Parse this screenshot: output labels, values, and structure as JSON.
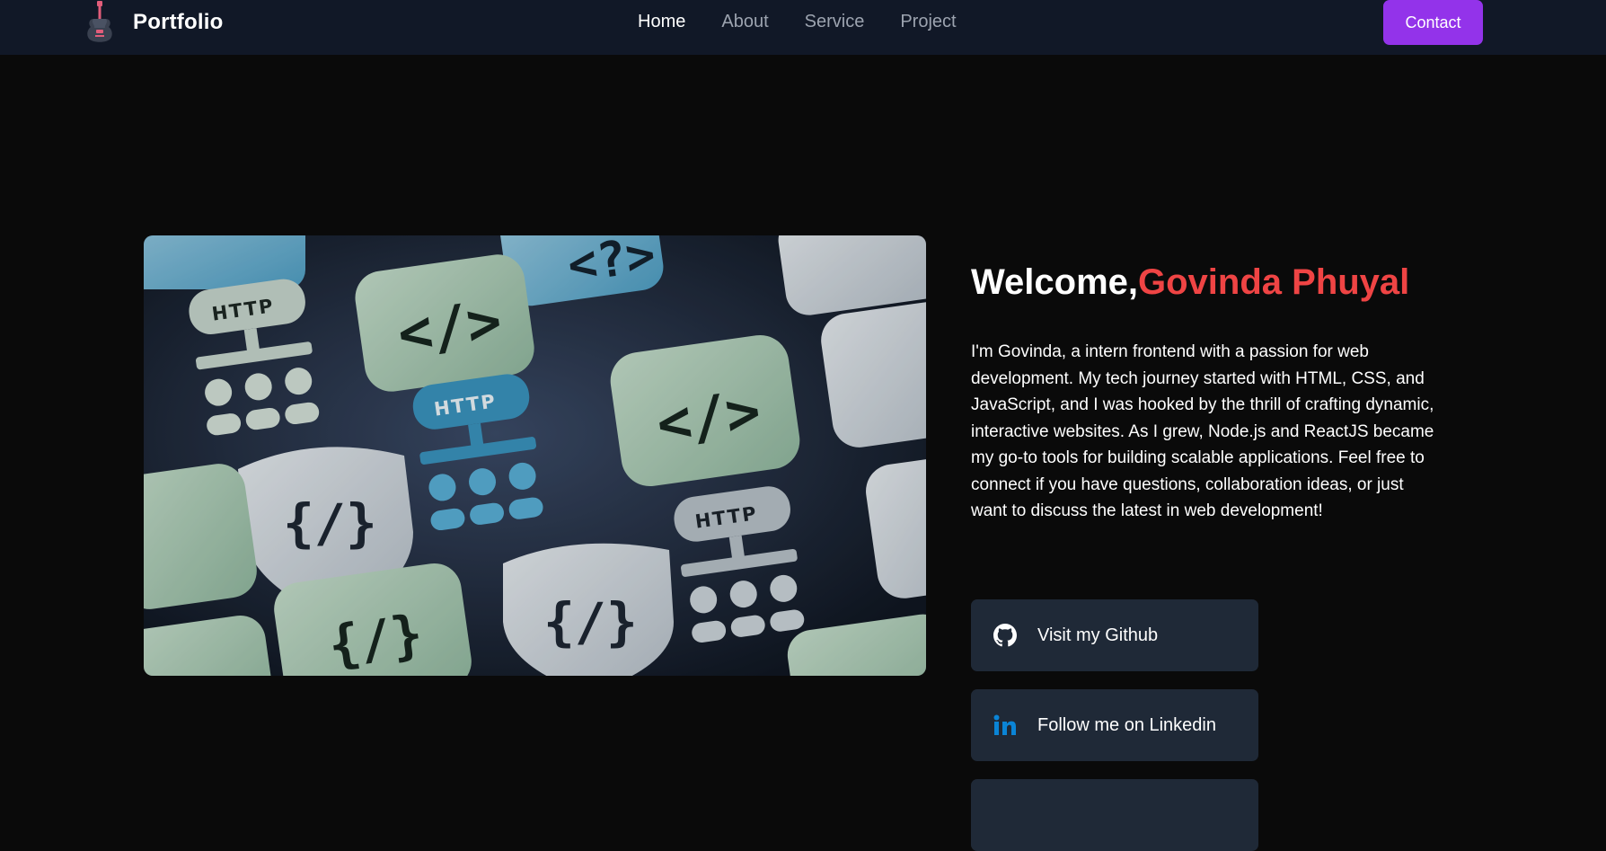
{
  "navbar": {
    "brand_title": "Portfolio",
    "links": [
      {
        "label": "Home",
        "active": true
      },
      {
        "label": "About",
        "active": false
      },
      {
        "label": "Service",
        "active": false
      },
      {
        "label": "Project",
        "active": false
      }
    ],
    "contact_label": "Contact",
    "accent_color": "#9333ea",
    "logo_icon": "guitar-icon"
  },
  "hero": {
    "image_icon": "http-code-keys-image",
    "image_texts": {
      "http": "HTTP",
      "code": "</>",
      "question": "<?>",
      "braces": "{/}"
    },
    "welcome_prefix": "Welcome,",
    "welcome_name": "Govinda Phuyal",
    "name_color": "#ef4444",
    "bio": "I'm Govinda, a intern frontend with a passion for web development. My tech journey started with HTML, CSS, and JavaScript, and I was hooked by the thrill of crafting dynamic, interactive websites. As I grew, Node.js and ReactJS became my go-to tools for building scalable applications. Feel free to connect if you have questions, collaboration ideas, or just want to discuss the latest in web development!",
    "buttons": [
      {
        "label": "Visit my Github",
        "icon": "github-icon"
      },
      {
        "label": "Follow me on Linkedin",
        "icon": "linkedin-icon"
      }
    ]
  }
}
